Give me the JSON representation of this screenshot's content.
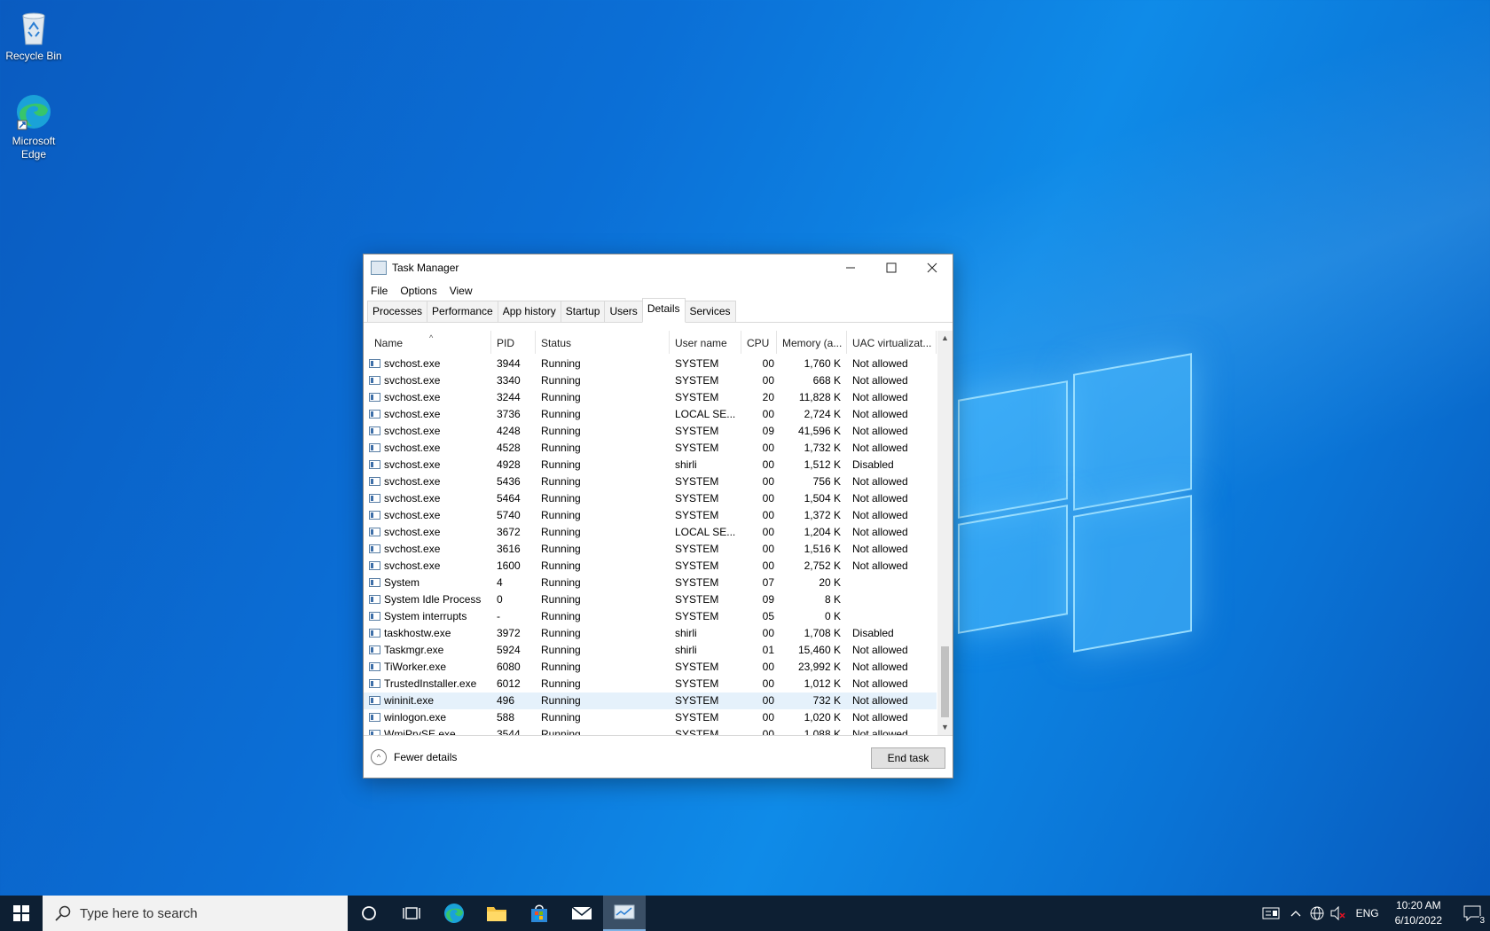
{
  "desktop": {
    "icons": [
      {
        "label": "Recycle Bin",
        "icon": "recycle-bin-icon"
      },
      {
        "label": "Microsoft Edge",
        "icon": "edge-icon"
      }
    ]
  },
  "window": {
    "title": "Task Manager",
    "menu": [
      "File",
      "Options",
      "View"
    ],
    "tabs": [
      "Processes",
      "Performance",
      "App history",
      "Startup",
      "Users",
      "Details",
      "Services"
    ],
    "active_tab": "Details",
    "columns": [
      "Name",
      "PID",
      "Status",
      "User name",
      "CPU",
      "Memory (a...",
      "UAC virtualizat..."
    ],
    "rows": [
      [
        "svchost.exe",
        "3944",
        "Running",
        "SYSTEM",
        "00",
        "1,760 K",
        "Not allowed"
      ],
      [
        "svchost.exe",
        "3340",
        "Running",
        "SYSTEM",
        "00",
        "668 K",
        "Not allowed"
      ],
      [
        "svchost.exe",
        "3244",
        "Running",
        "SYSTEM",
        "20",
        "11,828 K",
        "Not allowed"
      ],
      [
        "svchost.exe",
        "3736",
        "Running",
        "LOCAL SE...",
        "00",
        "2,724 K",
        "Not allowed"
      ],
      [
        "svchost.exe",
        "4248",
        "Running",
        "SYSTEM",
        "09",
        "41,596 K",
        "Not allowed"
      ],
      [
        "svchost.exe",
        "4528",
        "Running",
        "SYSTEM",
        "00",
        "1,732 K",
        "Not allowed"
      ],
      [
        "svchost.exe",
        "4928",
        "Running",
        "shirli",
        "00",
        "1,512 K",
        "Disabled"
      ],
      [
        "svchost.exe",
        "5436",
        "Running",
        "SYSTEM",
        "00",
        "756 K",
        "Not allowed"
      ],
      [
        "svchost.exe",
        "5464",
        "Running",
        "SYSTEM",
        "00",
        "1,504 K",
        "Not allowed"
      ],
      [
        "svchost.exe",
        "5740",
        "Running",
        "SYSTEM",
        "00",
        "1,372 K",
        "Not allowed"
      ],
      [
        "svchost.exe",
        "3672",
        "Running",
        "LOCAL SE...",
        "00",
        "1,204 K",
        "Not allowed"
      ],
      [
        "svchost.exe",
        "3616",
        "Running",
        "SYSTEM",
        "00",
        "1,516 K",
        "Not allowed"
      ],
      [
        "svchost.exe",
        "1600",
        "Running",
        "SYSTEM",
        "00",
        "2,752 K",
        "Not allowed"
      ],
      [
        "System",
        "4",
        "Running",
        "SYSTEM",
        "07",
        "20 K",
        ""
      ],
      [
        "System Idle Process",
        "0",
        "Running",
        "SYSTEM",
        "09",
        "8 K",
        ""
      ],
      [
        "System interrupts",
        "-",
        "Running",
        "SYSTEM",
        "05",
        "0 K",
        ""
      ],
      [
        "taskhostw.exe",
        "3972",
        "Running",
        "shirli",
        "00",
        "1,708 K",
        "Disabled"
      ],
      [
        "Taskmgr.exe",
        "5924",
        "Running",
        "shirli",
        "01",
        "15,460 K",
        "Not allowed"
      ],
      [
        "TiWorker.exe",
        "6080",
        "Running",
        "SYSTEM",
        "00",
        "23,992 K",
        "Not allowed"
      ],
      [
        "TrustedInstaller.exe",
        "6012",
        "Running",
        "SYSTEM",
        "00",
        "1,012 K",
        "Not allowed"
      ],
      [
        "wininit.exe",
        "496",
        "Running",
        "SYSTEM",
        "00",
        "732 K",
        "Not allowed"
      ],
      [
        "winlogon.exe",
        "588",
        "Running",
        "SYSTEM",
        "00",
        "1,020 K",
        "Not allowed"
      ],
      [
        "WmiPrvSE.exe",
        "3544",
        "Running",
        "SYSTEM",
        "00",
        "1,088 K",
        "Not allowed"
      ]
    ],
    "selected_row": "wininit.exe",
    "fewer_details": "Fewer details",
    "end_task": "End task"
  },
  "taskbar": {
    "search_placeholder": "Type here to search",
    "apps": [
      "cortana-icon",
      "task-view-icon",
      "edge-icon",
      "file-explorer-icon",
      "store-icon",
      "mail-icon",
      "task-manager-icon"
    ],
    "language": "ENG",
    "time": "10:20 AM",
    "date": "6/10/2022",
    "notification_count": "3"
  }
}
